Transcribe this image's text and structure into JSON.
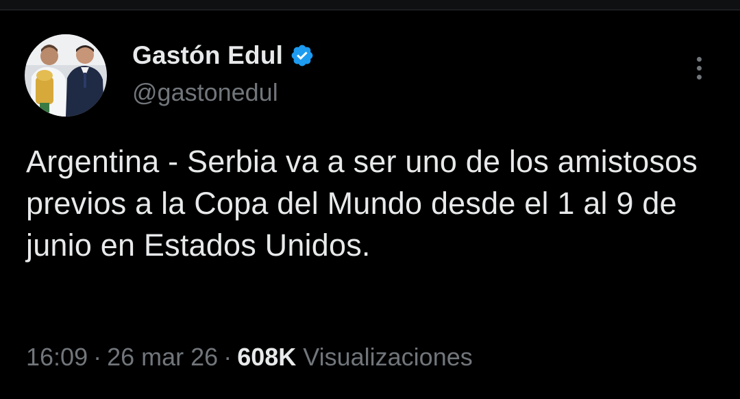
{
  "author": {
    "display_name": "Gastón Edul",
    "handle": "@gastonedul",
    "verified": true,
    "verified_color": "#1d9bf0"
  },
  "tweet": {
    "text": "Argentina - Serbia va a ser uno de los amistosos previos a la Copa del Mundo desde el 1 al 9 de junio en Estados Unidos.",
    "time": "16:09",
    "separator": "·",
    "date": "26 mar 26",
    "views_count": "608K",
    "views_label": "Visualizaciones"
  },
  "icons": {
    "more": "more-vertical-icon",
    "verified": "verified-badge-icon"
  },
  "colors": {
    "background": "#000000",
    "text_primary": "#e7e9ea",
    "text_secondary": "#71767b",
    "accent": "#1d9bf0"
  }
}
